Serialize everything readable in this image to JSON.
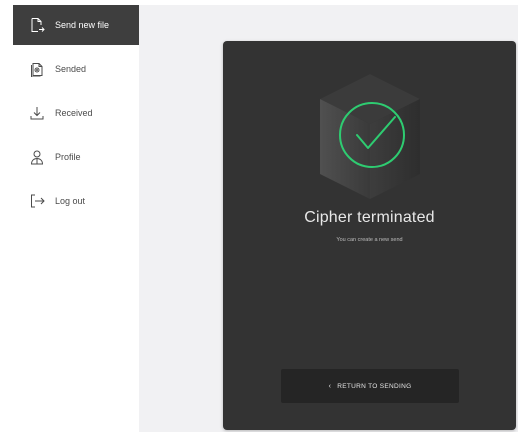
{
  "sidebar": {
    "items": [
      {
        "label": "Send new file",
        "icon": "send-file-icon",
        "active": true
      },
      {
        "label": "Sended",
        "icon": "sended-document-icon",
        "active": false
      },
      {
        "label": "Received",
        "icon": "download-icon",
        "active": false
      },
      {
        "label": "Profile",
        "icon": "profile-user-icon",
        "active": false
      },
      {
        "label": "Log out",
        "icon": "logout-icon",
        "active": false
      }
    ]
  },
  "result": {
    "icon": "check-circle-icon",
    "title": "Cipher terminated",
    "subtitle": "You can create a new send",
    "button_label": "RETURN TO SENDING",
    "button_icon": "chevron-left-icon"
  },
  "colors": {
    "sidebar_active_bg": "#3e3e3e",
    "panel_bg": "#333333",
    "button_bg": "#252525",
    "check_color": "#2ecc71",
    "content_bg": "#f1f1f3"
  }
}
